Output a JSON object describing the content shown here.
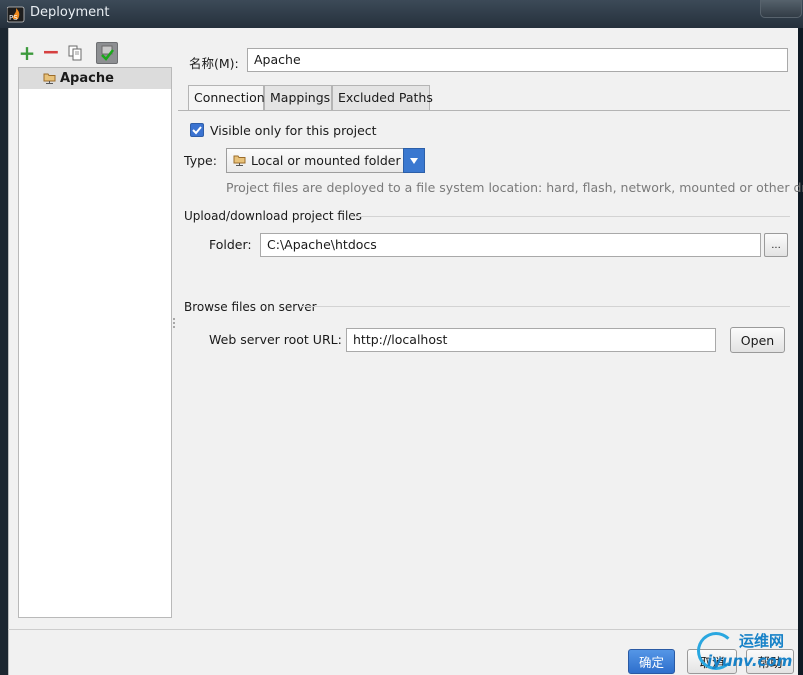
{
  "window": {
    "title": "Deployment"
  },
  "toolbar": {
    "add_icon": "plus-icon",
    "remove_icon": "minus-icon",
    "copy_icon": "copy-icon",
    "default_icon": "check-default-icon"
  },
  "server_list": {
    "items": [
      {
        "label": "Apache",
        "icon": "server-folder-icon",
        "selected": true
      }
    ]
  },
  "name_field": {
    "label": "名称(M):",
    "value": "Apache"
  },
  "tabs": [
    {
      "label": "Connection",
      "active": true
    },
    {
      "label": "Mappings",
      "active": false
    },
    {
      "label": "Excluded Paths",
      "active": false
    }
  ],
  "connection": {
    "visible_only_label": "Visible only for this project",
    "visible_only_checked": true,
    "type_label": "Type:",
    "type_value": "Local or mounted folder",
    "type_hint": "Project files are deployed to a file system location: hard, flash, network, mounted or other drive.",
    "upload_section": "Upload/download project files",
    "folder_label": "Folder:",
    "folder_value": "C:\\Apache\\htdocs",
    "browse_button": "...",
    "browse_section": "Browse files on server",
    "web_root_label": "Web server root URL:",
    "web_root_value": "http://localhost",
    "open_button": "Open"
  },
  "footer": {
    "ok": "确定",
    "cancel": "取消",
    "help": "帮助"
  },
  "watermark": {
    "cn": "运维网",
    "en": "iyunv.com"
  },
  "colors": {
    "accent": "#3a78d0",
    "titlebar": "#2f3b47",
    "dialog_bg": "#f1f1f1",
    "watermark": "#1782c8"
  }
}
